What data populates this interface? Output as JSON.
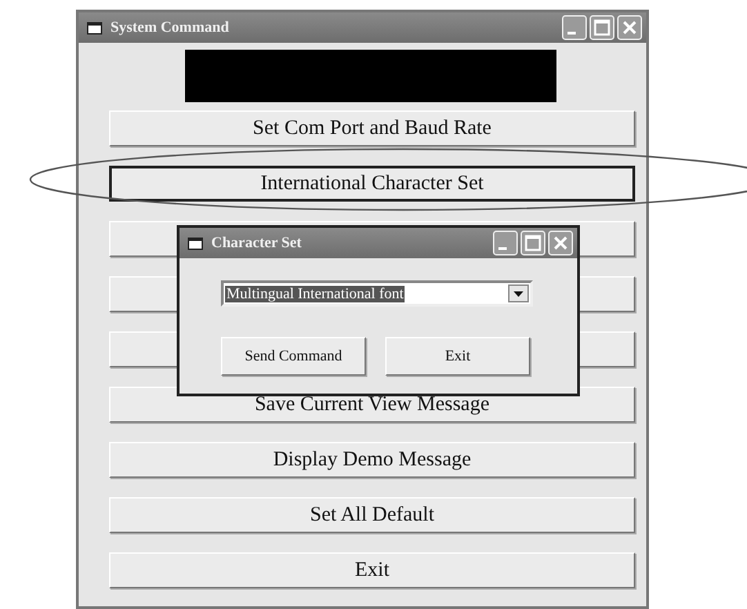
{
  "main_window": {
    "title": "System Command",
    "buttons": [
      {
        "kind": "labeled",
        "label": "Set Com Port and Baud Rate",
        "focused": false
      },
      {
        "kind": "labeled",
        "label": "International Character Set",
        "focused": true
      },
      {
        "kind": "covered"
      },
      {
        "kind": "covered"
      },
      {
        "kind": "covered"
      },
      {
        "kind": "labeled",
        "label": "Save Current View Message",
        "focused": false
      },
      {
        "kind": "labeled",
        "label": "Display Demo Message",
        "focused": false
      },
      {
        "kind": "labeled",
        "label": "Set All Default",
        "focused": false
      },
      {
        "kind": "labeled",
        "label": "Exit",
        "focused": false
      }
    ]
  },
  "dialog": {
    "title": "Character Set",
    "dropdown": {
      "value": "Multingual International font"
    },
    "buttons": [
      {
        "label": "Send Command"
      },
      {
        "label": "Exit"
      }
    ]
  }
}
